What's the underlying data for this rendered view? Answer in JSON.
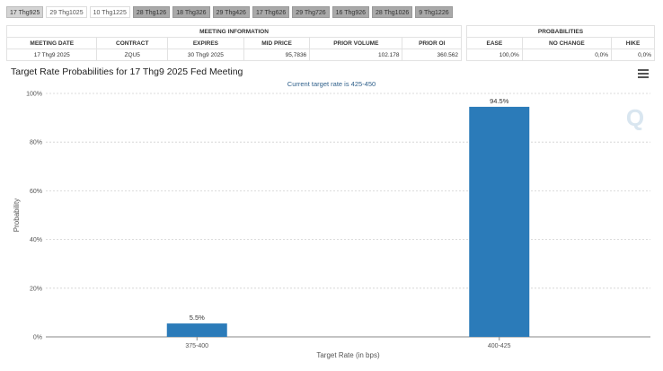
{
  "tabs": [
    {
      "label": "17 Thg925",
      "state": "active"
    },
    {
      "label": "29 Thg1025",
      "state": "light"
    },
    {
      "label": "10 Thg1225",
      "state": "light"
    },
    {
      "label": "28 Thg126",
      "state": ""
    },
    {
      "label": "18 Thg326",
      "state": ""
    },
    {
      "label": "29 Thg426",
      "state": ""
    },
    {
      "label": "17 Thg626",
      "state": ""
    },
    {
      "label": "29 Thg726",
      "state": ""
    },
    {
      "label": "16 Thg926",
      "state": ""
    },
    {
      "label": "28 Thg1026",
      "state": ""
    },
    {
      "label": "9 Thg1226",
      "state": ""
    }
  ],
  "meeting_info": {
    "header": "MEETING INFORMATION",
    "columns": [
      "MEETING DATE",
      "CONTRACT",
      "EXPIRES",
      "MID PRICE",
      "PRIOR VOLUME",
      "PRIOR OI"
    ],
    "row": [
      "17 Thg9 2025",
      "ZQU5",
      "30 Thg9 2025",
      "95,7836",
      "102.178",
      "360.562"
    ]
  },
  "probabilities": {
    "header": "PROBABILITIES",
    "columns": [
      "EASE",
      "NO CHANGE",
      "HIKE"
    ],
    "row": [
      "100,0%",
      "0,0%",
      "0,0%"
    ]
  },
  "chart_title": "Target Rate Probabilities for 17 Thg9 2025 Fed Meeting",
  "colors": {
    "bar": "#2b7bb9",
    "grid": "#d0d0d0",
    "subtitle": "#2e5f8a",
    "watermark": "#d9e6f0"
  },
  "icons": {
    "menu": "hamburger-menu-icon",
    "watermark": "q-logo-icon"
  },
  "chart_data": {
    "type": "bar",
    "title": "",
    "subtitle": "Current target rate is 425-450",
    "xlabel": "Target Rate (in bps)",
    "ylabel": "Probability",
    "categories": [
      "375-400",
      "400-425"
    ],
    "values": [
      5.5,
      94.5
    ],
    "data_labels": [
      "5.5%",
      "94.5%"
    ],
    "ylim": [
      0,
      100
    ],
    "yticks": [
      0,
      20,
      40,
      60,
      80,
      100
    ],
    "ytick_labels": [
      "0%",
      "20%",
      "40%",
      "60%",
      "80%",
      "100%"
    ],
    "grid": true
  }
}
